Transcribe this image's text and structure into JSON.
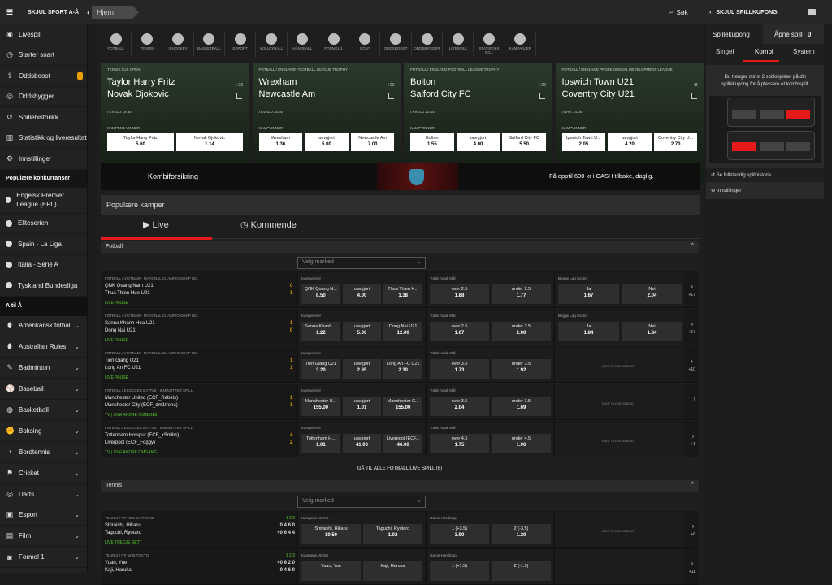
{
  "topbar": {
    "hide_sports": "SKJUL SPORT A-Å",
    "crumb": "Hjem",
    "search": "Søk",
    "hide_slip": "SKJUL SPILLKUPONG"
  },
  "sidebar": {
    "top": [
      {
        "icon": "◉",
        "label": "Livespill"
      },
      {
        "icon": "◷",
        "label": "Starter snart"
      },
      {
        "icon": "⇧",
        "label": "Oddsboost"
      },
      {
        "icon": "◎",
        "label": "Oddsbygger"
      },
      {
        "icon": "↺",
        "label": "Spillehistorikk"
      },
      {
        "icon": "▥",
        "label": "Statistikk og liveresultat"
      },
      {
        "icon": "⚙",
        "label": "Innstillinger"
      }
    ],
    "popular_head": "Populære konkurranser",
    "popular": [
      {
        "label": "Engelsk Premier League (EPL)"
      },
      {
        "label": "Eliteserien"
      },
      {
        "label": "Spain - La Liga"
      },
      {
        "label": "Italia - Serie A"
      },
      {
        "label": "Tyskland Bundesliga"
      }
    ],
    "az_head": "A til Å",
    "az": [
      {
        "icon": "⬮",
        "label": "Amerikansk fotball"
      },
      {
        "icon": "⬮",
        "label": "Australian Rules"
      },
      {
        "icon": "✎",
        "label": "Badminton"
      },
      {
        "icon": "⚾",
        "label": "Baseball"
      },
      {
        "icon": "◍",
        "label": "Basketball"
      },
      {
        "icon": "✊",
        "label": "Boksing"
      },
      {
        "icon": "◔",
        "label": "Bordtennis"
      },
      {
        "icon": "⚑",
        "label": "Cricket"
      },
      {
        "icon": "◎",
        "label": "Darts"
      },
      {
        "icon": "▣",
        "label": "Esport"
      },
      {
        "icon": "▤",
        "label": "Film"
      },
      {
        "icon": "◙",
        "label": "Formel 1"
      }
    ]
  },
  "sports": [
    "FOTBALL",
    "TENNIS",
    "ISHOCKEY",
    "BASKETBALL",
    "ESPORT",
    "VOLLEYBALL",
    "HÅNDBALL",
    "FORMEL 1",
    "GOLF",
    "ODDSBOOST",
    "ODDSBYGGER",
    "LIVESPILL",
    "STATISTIKK OG...",
    "KAMPANJER"
  ],
  "cards": [
    {
      "cat": "TENNIS / US OPEN",
      "t1": "Taylor Harry Fritz",
      "t2": "Novak Djokovic",
      "time": "I KVELD 19:30",
      "market": "KAMPENS VINNER",
      "more": "+23",
      "odds": [
        {
          "n": "Taylor Harry Fritz",
          "v": "5.60"
        },
        {
          "n": "Novak Djokovic",
          "v": "1.14"
        }
      ]
    },
    {
      "cat": "FOTBALL / ENGLAND FOOTBALL LEAGUE TROPHY",
      "t1": "Wrexham",
      "t2": "Newcastle Am",
      "time": "I KVELD 20:30",
      "market": "KAMPVINNER",
      "more": "+22",
      "odds": [
        {
          "n": "Wrexham",
          "v": "1.36"
        },
        {
          "n": "uavgjort",
          "v": "5.00"
        },
        {
          "n": "Newcastle Am",
          "v": "7.00"
        }
      ]
    },
    {
      "cat": "FOTBALL / ENGLAND FOOTBALL LEAGUE TROPHY",
      "t1": "Bolton",
      "t2": "Salford City FC",
      "time": "I KVELD 20:45",
      "market": "KAMPVINNER",
      "more": "+22",
      "odds": [
        {
          "n": "Bolton",
          "v": "1.55"
        },
        {
          "n": "uavgjort",
          "v": "4.00"
        },
        {
          "n": "Salford City FC",
          "v": "5.50"
        }
      ]
    },
    {
      "cat": "FOTBALL / ENGLAND PROFESSIONAL DEVELOPMENT LEAGUE",
      "t1": "Ipswich Town U21",
      "t2": "Coventry City U21",
      "time": "I DAG 14:00",
      "market": "KAMPVINNER",
      "more": "+8",
      "odds": [
        {
          "n": "Ipswich Town U...",
          "v": "2.05"
        },
        {
          "n": "uavgjort",
          "v": "4.20"
        },
        {
          "n": "Coventry City U...",
          "v": "2.70"
        }
      ]
    }
  ],
  "promo": {
    "title": "Kombiforsikring",
    "text": "Få opptil 600 kr i CASH tilbake, daglig."
  },
  "popular_title": "Populære kamper",
  "tabs": {
    "live": "Live",
    "upcoming": "Kommende"
  },
  "football": {
    "title": "Fotball",
    "select": "Velg marked",
    "all": "GÅ TIL ALLE FOTBALL LIVE SPILL  (6)",
    "rows": [
      {
        "cat": "FOTBALL / VIETNAM - NATIONAL CHAMPIONSHIP U21",
        "t1": "QNK Quang Nam U21",
        "t2": "Thua Thien Hue U21",
        "s1": "0",
        "s2": "1",
        "status": "LIVE PAUSE",
        "m1": "Kampvinner",
        "o1": [
          {
            "n": "QNK Quang N...",
            "v": "8.50"
          },
          {
            "n": "uavgjort",
            "v": "4.00"
          },
          {
            "n": "Thua Thien H...",
            "v": "1.38"
          }
        ],
        "m2": "Totalt Antall Mål",
        "o2": [
          {
            "n": "over 2.5",
            "v": "1.88"
          },
          {
            "n": "under 2.5",
            "v": "1.77"
          }
        ],
        "m3": "Begge Lag Scorer",
        "o3": [
          {
            "n": "Ja",
            "v": "1.67"
          },
          {
            "n": "Nei",
            "v": "2.04"
          }
        ],
        "more": "+17"
      },
      {
        "cat": "FOTBALL / VIETNAM - NATIONAL CHAMPIONSHIP U21",
        "t1": "Sanna Khanh Hoa U21",
        "t2": "Dong Nai U21",
        "s1": "1",
        "s2": "0",
        "status": "LIVE PAUSE",
        "m1": "Kampvinner",
        "o1": [
          {
            "n": "Sanna Khanh ...",
            "v": "1.22"
          },
          {
            "n": "uavgjort",
            "v": "5.00"
          },
          {
            "n": "Dong Nai U21",
            "v": "12.00"
          }
        ],
        "m2": "Totalt Antall Mål",
        "o2": [
          {
            "n": "over 2.5",
            "v": "1.67"
          },
          {
            "n": "under 2.5",
            "v": "2.00"
          }
        ],
        "m3": "Begge Lag Scorer",
        "o3": [
          {
            "n": "Ja",
            "v": "1.84"
          },
          {
            "n": "Nei",
            "v": "1.84"
          }
        ],
        "more": "+17"
      },
      {
        "cat": "FOTBALL / VIETNAM - NATIONAL CHAMPIONSHIP U21",
        "t1": "Tien Giang U21",
        "t2": "Long An FC U21",
        "s1": "1",
        "s2": "1",
        "status": "LIVE PAUSE",
        "m1": "Kampvinner",
        "o1": [
          {
            "n": "Tien Giang U21",
            "v": "3.20"
          },
          {
            "n": "uavgjort",
            "v": "2.85"
          },
          {
            "n": "Long An FC U21",
            "v": "2.30"
          }
        ],
        "m2": "Totalt Antall Mål",
        "o2": [
          {
            "n": "over 3.5",
            "v": "1.73"
          },
          {
            "n": "under 3.5",
            "v": "1.92"
          }
        ],
        "m3": "",
        "o3": [],
        "na": "IKKE TILGJENGELIG",
        "more": "+10"
      },
      {
        "cat": "FOTBALL / ESOCCER BATTLE - 8 MINUTTER SPILL",
        "t1": "Manchester United (ECF_Rebels)",
        "t2": "Manchester City (ECF_dm1trena)",
        "s1": "1",
        "s2": "1",
        "status": "TV | LIVE ANDRE OMGANG",
        "m1": "Kampvinner",
        "o1": [
          {
            "n": "Manchester U...",
            "v": "155.00"
          },
          {
            "n": "uavgjort",
            "v": "1.01"
          },
          {
            "n": "Manchester C...",
            "v": "155.00"
          }
        ],
        "m2": "Totalt Antall Mål",
        "o2": [
          {
            "n": "over 3.5",
            "v": "2.04"
          },
          {
            "n": "under 3.5",
            "v": "1.69"
          }
        ],
        "m3": "",
        "o3": [],
        "na": "IKKE TILGJENGELIG",
        "more": ""
      },
      {
        "cat": "FOTBALL / ESOCCER BATTLE - 8 MINUTTER SPILL",
        "t1": "Tottenham Hotspur (ECF_xSmilrs)",
        "t2": "Liverpool (ECF_Foggy)",
        "s1": "4",
        "s2": "2",
        "status": "TV | LIVE ANDRE OMGANG",
        "m1": "Kampvinner",
        "o1": [
          {
            "n": "Tottenham H...",
            "v": "1.01"
          },
          {
            "n": "uavgjort",
            "v": "41.00"
          },
          {
            "n": "Liverpool (ECF...",
            "v": "46.00"
          }
        ],
        "m2": "Totalt Antall Mål",
        "o2": [
          {
            "n": "over 4.5",
            "v": "1.75"
          },
          {
            "n": "under 4.5",
            "v": "1.96"
          }
        ],
        "m3": "",
        "o3": [],
        "na": "IKKE TILGJENGELIG",
        "more": "+1"
      }
    ]
  },
  "tennis": {
    "title": "Tennis",
    "select": "Velg marked",
    "rows": [
      {
        "cat": "TENNIS / ITF M25 SAPPORO",
        "t1": "Shiraishi, Hikaru",
        "t2": "Taguchi, Ryotaro",
        "s1": "0  4  6  0",
        "s2": "+0  6  4  4",
        "sh": "1  2  3",
        "status": "LIVE TREDJE SETT",
        "m1": "Kampens Vinner",
        "o1": [
          {
            "n": "Shiraishi, Hikaru",
            "v": "10.50"
          },
          {
            "n": "Taguchi, Ryotaro",
            "v": "1.02"
          }
        ],
        "m2": "Game-Handicap",
        "o2": [
          {
            "n": "1 (+3.5)",
            "v": "3.90"
          },
          {
            "n": "2 (-3.5)",
            "v": "1.20"
          }
        ],
        "na": "IKKE TILGJENGELIG",
        "more": "+6"
      },
      {
        "cat": "TENNIS / ITF W35 TOKYO",
        "t1": "Yuan, Yue",
        "t2": "Kaji, Haruka",
        "s1": "+0  6  2  0",
        "s2": "0  4  6  0",
        "sh": "1  2  3",
        "status": "",
        "m1": "Kampens Vinner",
        "o1": [
          {
            "n": "Yuan, Yue",
            "v": ""
          },
          {
            "n": "Kaji, Haruka",
            "v": ""
          }
        ],
        "m2": "Game-Handicap",
        "o2": [
          {
            "n": "1 (+1.5)",
            "v": ""
          },
          {
            "n": "2 (-1.5)",
            "v": ""
          }
        ],
        "na": "",
        "more": "+11"
      }
    ]
  },
  "slip": {
    "tab1": "Spillekupong",
    "tab2": "Åpne spill",
    "tab2_count": "0",
    "sub": [
      "Singel",
      "Kombi",
      "System"
    ],
    "msg": "Du trenger minst 2 spillobjekter på din spillekupong for å plassere et kombispill.",
    "history": "Se fullstendig spillhistorie",
    "settings": "Innstillinger"
  },
  "colors": {
    "accent": "#e51a1a",
    "live": "#58c72e",
    "score": "#f0a800"
  }
}
